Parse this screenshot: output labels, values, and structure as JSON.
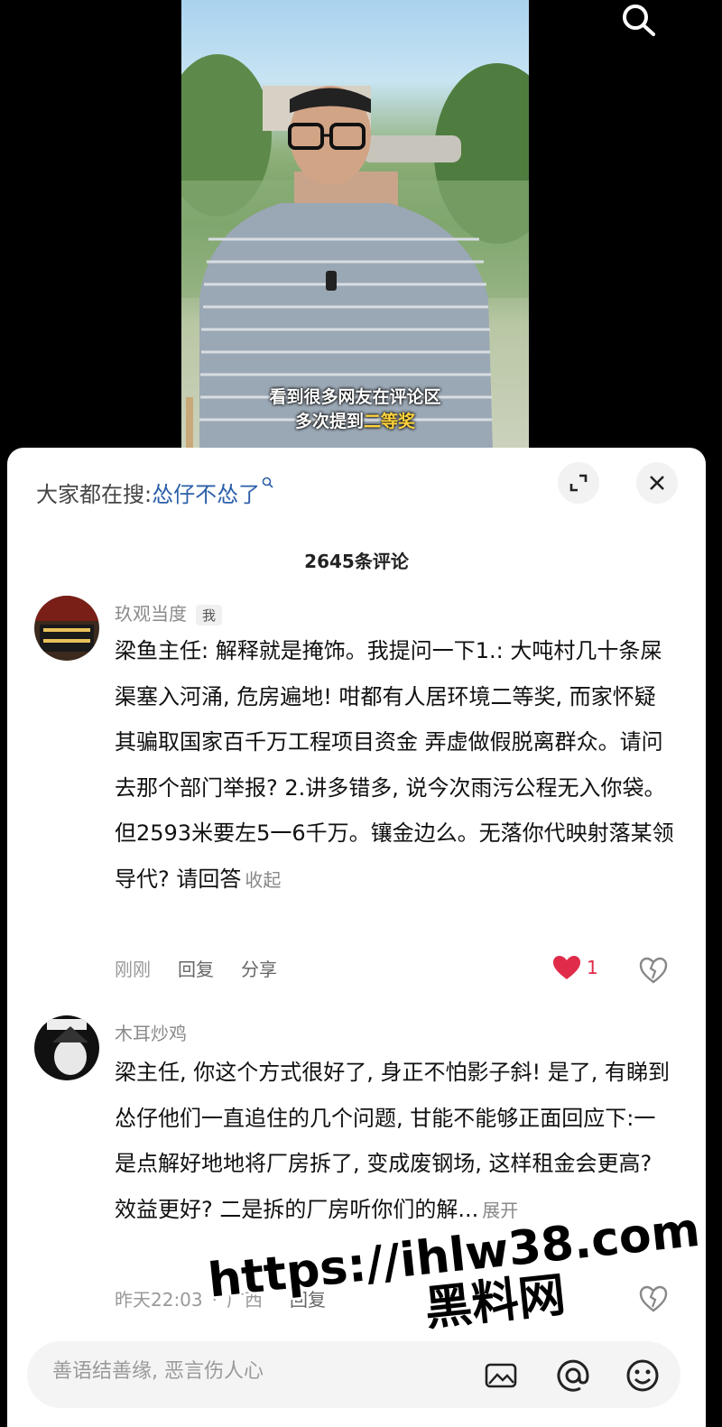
{
  "video": {
    "caption_line1": "看到很多网友在评论区",
    "caption_line2_prefix": "多次提到",
    "caption_line2_highlight": "二等奖",
    "search_icon": "search-icon"
  },
  "sheet": {
    "trending_label": "大家都在搜:",
    "trending_keyword": "怂仔不怂了",
    "comment_count": "2645条评论"
  },
  "comments": [
    {
      "username": "玖观当度",
      "badge": "我",
      "text": "梁鱼主任: 解释就是掩饰。我提问一下1.: 大吨村几十条屎渠塞入河涌, 危房遍地! 咁都有人居环境二等奖, 而家怀疑其骗取国家百千万工程项目资金 弄虚做假脱离群众。请问去那个部门举报? 2.讲多错多, 说今次雨污公程无入你袋。但2593米要左5一6千万。镶金边么。无落你代映射落某领导代? 请回答",
      "fold_label": "收起",
      "time": "刚刚",
      "reply_label": "回复",
      "share_label": "分享",
      "likes": "1"
    },
    {
      "username": "木耳炒鸡",
      "text": "梁主任, 你这个方式很好了, 身正不怕影子斜! 是了, 有睇到怂仔他们一直追住的几个问题, 甘能不能够正面回应下:一是点解好地地将厂房拆了, 变成废钢场, 这样租金会更高? 效益更好? 二是拆的厂房听你们的解...",
      "fold_label": "展开",
      "time": "昨天22:03",
      "location": "广西",
      "reply_label": "回复"
    }
  ],
  "input": {
    "placeholder": "善语结善缘, 恶言伤人心"
  },
  "watermark": {
    "line1": "https://ihlw38.com",
    "line2": "黑料网"
  },
  "colors": {
    "accent_like": "#e02b4a",
    "trend_keyword": "#2b5fa8",
    "caption_highlight": "#ffd33d"
  }
}
